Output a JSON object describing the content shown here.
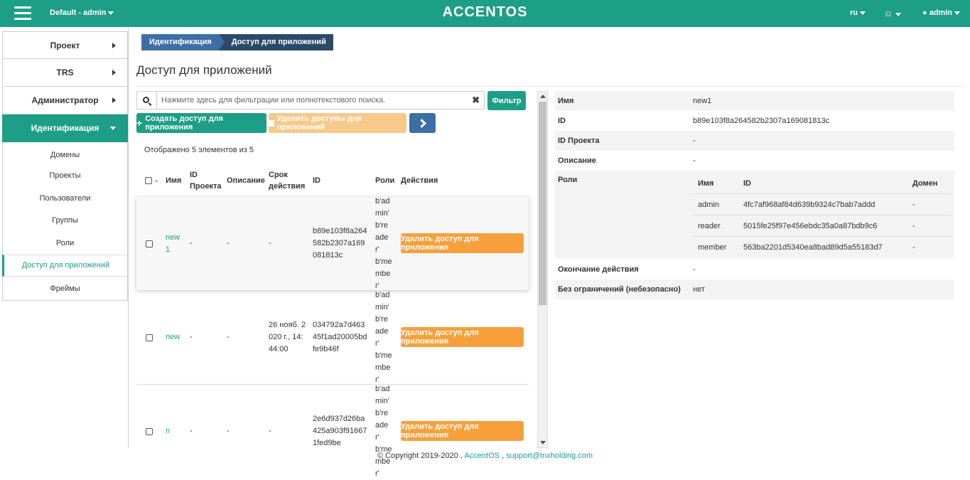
{
  "header": {
    "context": "Default - admin",
    "logo": "ACCENTOS",
    "language": "ru",
    "user": "admin"
  },
  "sidebar": {
    "items": [
      {
        "label": "Проект"
      },
      {
        "label": "TRS"
      },
      {
        "label": "Администратор"
      },
      {
        "label": "Идентификация"
      }
    ],
    "subitems": [
      {
        "label": "Домены"
      },
      {
        "label": "Проекты"
      },
      {
        "label": "Пользователи"
      },
      {
        "label": "Группы"
      },
      {
        "label": "Роли"
      },
      {
        "label": "Доступ для приложений"
      },
      {
        "label": "Фреймы"
      }
    ]
  },
  "breadcrumb": {
    "parent": "Идентификация",
    "current": "Доступ для приложений"
  },
  "page_title": "Доступ для приложений",
  "search": {
    "placeholder": "Нажмите здесь для фильтрации или полнотекстового поиска.",
    "clear": "✖",
    "filter_label": "Фильтр"
  },
  "toolbar": {
    "create_label": "Создать доступ для приложения",
    "delete_label": "Удалить доступы для приложений",
    "create_icon": "+",
    "delete_icon": "🗑"
  },
  "count_text": "Отображено 5 элементов из 5",
  "table": {
    "headers": {
      "name": "Имя",
      "project_id": "ID Проекта",
      "description": "Описание",
      "expires": "Срок действия",
      "id": "ID",
      "roles": "Роли",
      "actions": "Действия"
    },
    "action_label": "Удалить доступ для приложения",
    "rows": [
      {
        "name": "new1",
        "project_id": "-",
        "description": "-",
        "expires": "-",
        "id": "b89e103f8a264582b2307a169081813c",
        "roles": "b'admin' b'reader' b'member'"
      },
      {
        "name": "new",
        "project_id": "-",
        "description": "-",
        "expires": "26 нояб. 2020 г., 14:44:00",
        "id": "034792a7d46345f1ad20005bdfe9b46f",
        "roles": "b'admin' b'reader' b'member'"
      },
      {
        "name": "n",
        "project_id": "-",
        "description": "-",
        "expires": "-",
        "id": "2e6d937d26ba425a903f916671fed9be",
        "roles": "b'admin' b'reader' b'member'"
      }
    ]
  },
  "detail": {
    "name_label": "Имя",
    "name": "new1",
    "id_label": "ID",
    "id": "b89e103f8a264582b2307a169081813c",
    "project_label": "ID Проекта",
    "project": "-",
    "desc_label": "Описание",
    "desc": "-",
    "roles_label": "Роли",
    "roles_headers": {
      "name": "Имя",
      "id": "ID",
      "domain": "Домен"
    },
    "roles": [
      {
        "name": "admin",
        "id": "4fc7af968af84d639b9324c7bab7addd",
        "domain": "-"
      },
      {
        "name": "reader",
        "id": "5015fe25f97e456ebdc35a0a87bdb9c6",
        "domain": "-"
      },
      {
        "name": "member",
        "id": "563ba2201d5340ea8bad89d5a55183d7",
        "domain": "-"
      }
    ],
    "expires_label": "Окончание действия",
    "expires": "-",
    "unrestricted_label": "Без ограничений (небезопасно)",
    "unrestricted": "нет"
  },
  "footer": {
    "copyright": "© Copyright 2019-2020 ,",
    "brand": "AccentOS",
    "sep": ",",
    "email": "support@tnxholding.com"
  }
}
